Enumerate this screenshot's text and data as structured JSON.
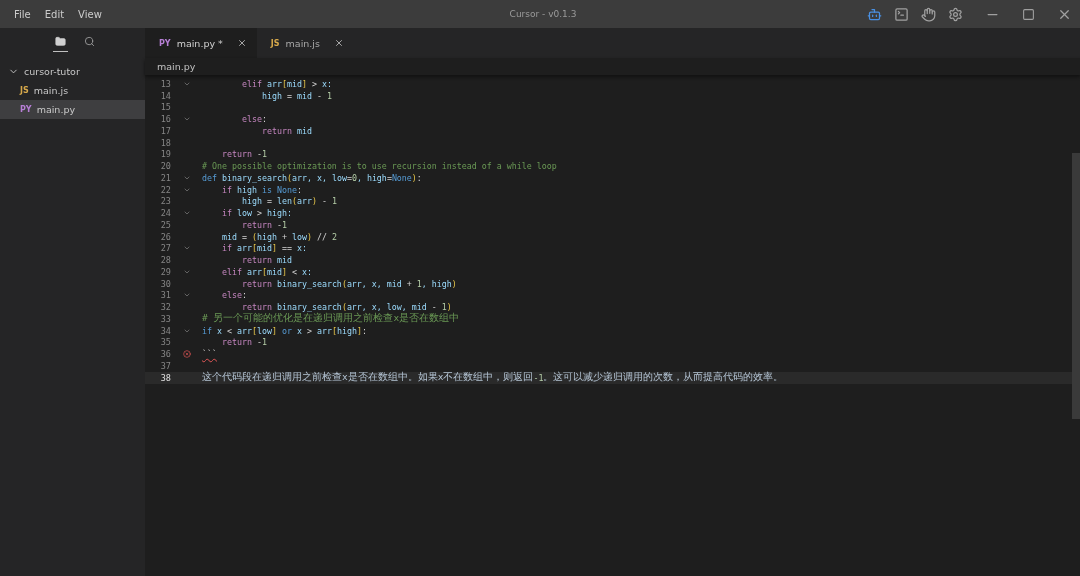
{
  "window": {
    "title": "Cursor - v0.1.3"
  },
  "menu": [
    "File",
    "Edit",
    "View"
  ],
  "toolbar": [
    {
      "kind": "bot",
      "active": true
    },
    {
      "kind": "terminal",
      "active": false
    },
    {
      "kind": "hand",
      "active": false
    },
    {
      "kind": "settings",
      "active": false
    }
  ],
  "sidebar": {
    "tabs": [
      {
        "kind": "files",
        "selected": true
      },
      {
        "kind": "search",
        "selected": false
      }
    ],
    "tree": [
      {
        "label": "cursor-tutor",
        "expanded": true,
        "selected": false,
        "children": [
          {
            "badge": "JS",
            "color": "#d7a94b",
            "label": "main.js",
            "selected": false
          },
          {
            "badge": "PY",
            "color": "#b77fd6",
            "label": "main.py",
            "selected": true
          }
        ]
      }
    ]
  },
  "tabs": [
    {
      "badge": "PY",
      "color": "#b77fd6",
      "label": "main.py *",
      "selected": true
    },
    {
      "badge": "JS",
      "color": "#d7a94b",
      "label": "main.js",
      "selected": false
    }
  ],
  "breadcrumb": "main.py",
  "lines": [
    {
      "number": "13",
      "fold": true,
      "error": false,
      "current": false,
      "tokens": [
        {
          "kind": "k",
          "text": "        elif"
        },
        {
          "kind": "p",
          "text": " arr"
        },
        {
          "kind": "b",
          "text": "["
        },
        {
          "kind": "p",
          "text": "mid"
        },
        {
          "kind": "b",
          "text": "]"
        },
        {
          "kind": "o",
          "text": " > "
        },
        {
          "kind": "p",
          "text": "x:"
        }
      ]
    },
    {
      "number": "14",
      "fold": false,
      "error": false,
      "current": false,
      "tokens": [
        {
          "kind": "p",
          "text": "            high "
        },
        {
          "kind": "o",
          "text": "= "
        },
        {
          "kind": "p",
          "text": "mid "
        },
        {
          "kind": "o",
          "text": "- "
        },
        {
          "kind": "n",
          "text": "1"
        }
      ]
    },
    {
      "number": "15",
      "fold": false,
      "error": false,
      "current": false
    },
    {
      "number": "16",
      "fold": true,
      "error": false,
      "current": false,
      "tokens": [
        {
          "kind": "k",
          "text": "        else"
        },
        {
          "kind": "o",
          "text": ":"
        }
      ]
    },
    {
      "number": "17",
      "fold": false,
      "error": false,
      "current": false,
      "tokens": [
        {
          "kind": "k",
          "text": "            return"
        },
        {
          "kind": "p",
          "text": " mid"
        }
      ]
    },
    {
      "number": "18",
      "fold": false,
      "error": false,
      "current": false
    },
    {
      "number": "19",
      "fold": false,
      "error": false,
      "current": false,
      "tokens": [
        {
          "kind": "k",
          "text": "    return"
        },
        {
          "kind": "o",
          "text": " -"
        },
        {
          "kind": "n",
          "text": "1"
        }
      ]
    },
    {
      "number": "20",
      "fold": false,
      "error": false,
      "current": false,
      "tokens": [
        {
          "kind": "c",
          "text": "# One possible optimization is to use recursion instead of a while loop"
        }
      ]
    },
    {
      "number": "21",
      "fold": true,
      "error": false,
      "current": false,
      "tokens": [
        {
          "kind": "d",
          "text": "def"
        },
        {
          "kind": "f",
          "text": " binary_search"
        },
        {
          "kind": "b",
          "text": "("
        },
        {
          "kind": "p",
          "text": "arr, x, low"
        },
        {
          "kind": "o",
          "text": "="
        },
        {
          "kind": "n",
          "text": "0"
        },
        {
          "kind": "p",
          "text": ", high"
        },
        {
          "kind": "o",
          "text": "="
        },
        {
          "kind": "d",
          "text": "None"
        },
        {
          "kind": "b",
          "text": ")"
        },
        {
          "kind": "o",
          "text": ":"
        }
      ]
    },
    {
      "number": "22",
      "fold": true,
      "error": false,
      "current": false,
      "tokens": [
        {
          "kind": "k",
          "text": "    if"
        },
        {
          "kind": "p",
          "text": " high "
        },
        {
          "kind": "d",
          "text": "is None"
        },
        {
          "kind": "o",
          "text": ":"
        }
      ]
    },
    {
      "number": "23",
      "fold": false,
      "error": false,
      "current": false,
      "tokens": [
        {
          "kind": "p",
          "text": "        high "
        },
        {
          "kind": "o",
          "text": "= "
        },
        {
          "kind": "f",
          "text": "len"
        },
        {
          "kind": "b",
          "text": "("
        },
        {
          "kind": "p",
          "text": "arr"
        },
        {
          "kind": "b",
          "text": ")"
        },
        {
          "kind": "o",
          "text": " - "
        },
        {
          "kind": "n",
          "text": "1"
        }
      ]
    },
    {
      "number": "24",
      "fold": true,
      "error": false,
      "current": false,
      "tokens": [
        {
          "kind": "k",
          "text": "    if"
        },
        {
          "kind": "p",
          "text": " low "
        },
        {
          "kind": "o",
          "text": "> "
        },
        {
          "kind": "p",
          "text": "high:"
        }
      ]
    },
    {
      "number": "25",
      "fold": false,
      "error": false,
      "current": false,
      "tokens": [
        {
          "kind": "k",
          "text": "        return"
        },
        {
          "kind": "o",
          "text": " -"
        },
        {
          "kind": "n",
          "text": "1"
        }
      ]
    },
    {
      "number": "26",
      "fold": false,
      "error": false,
      "current": false,
      "tokens": [
        {
          "kind": "p",
          "text": "    mid "
        },
        {
          "kind": "o",
          "text": "= "
        },
        {
          "kind": "b",
          "text": "("
        },
        {
          "kind": "p",
          "text": "high "
        },
        {
          "kind": "o",
          "text": "+ "
        },
        {
          "kind": "p",
          "text": "low"
        },
        {
          "kind": "b",
          "text": ")"
        },
        {
          "kind": "o",
          "text": " // "
        },
        {
          "kind": "n",
          "text": "2"
        }
      ]
    },
    {
      "number": "27",
      "fold": true,
      "error": false,
      "current": false,
      "tokens": [
        {
          "kind": "k",
          "text": "    if"
        },
        {
          "kind": "p",
          "text": " arr"
        },
        {
          "kind": "b",
          "text": "["
        },
        {
          "kind": "p",
          "text": "mid"
        },
        {
          "kind": "b",
          "text": "]"
        },
        {
          "kind": "o",
          "text": " == "
        },
        {
          "kind": "p",
          "text": "x:"
        }
      ]
    },
    {
      "number": "28",
      "fold": false,
      "error": false,
      "current": false,
      "tokens": [
        {
          "kind": "k",
          "text": "        return"
        },
        {
          "kind": "p",
          "text": " mid"
        }
      ]
    },
    {
      "number": "29",
      "fold": true,
      "error": false,
      "current": false,
      "tokens": [
        {
          "kind": "k",
          "text": "    elif"
        },
        {
          "kind": "p",
          "text": " arr"
        },
        {
          "kind": "b",
          "text": "["
        },
        {
          "kind": "p",
          "text": "mid"
        },
        {
          "kind": "b",
          "text": "]"
        },
        {
          "kind": "o",
          "text": " < "
        },
        {
          "kind": "p",
          "text": "x:"
        }
      ]
    },
    {
      "number": "30",
      "fold": false,
      "error": false,
      "current": false,
      "tokens": [
        {
          "kind": "k",
          "text": "        return"
        },
        {
          "kind": "f",
          "text": " binary_search"
        },
        {
          "kind": "b",
          "text": "("
        },
        {
          "kind": "p",
          "text": "arr, x, mid "
        },
        {
          "kind": "o",
          "text": "+ "
        },
        {
          "kind": "n",
          "text": "1"
        },
        {
          "kind": "p",
          "text": ", high"
        },
        {
          "kind": "b",
          "text": ")"
        }
      ]
    },
    {
      "number": "31",
      "fold": true,
      "error": false,
      "current": false,
      "tokens": [
        {
          "kind": "k",
          "text": "    else"
        },
        {
          "kind": "o",
          "text": ":"
        }
      ]
    },
    {
      "number": "32",
      "fold": false,
      "error": false,
      "current": false,
      "tokens": [
        {
          "kind": "k",
          "text": "        return"
        },
        {
          "kind": "f",
          "text": " binary_search"
        },
        {
          "kind": "b",
          "text": "("
        },
        {
          "kind": "p",
          "text": "arr, x, low, mid "
        },
        {
          "kind": "o",
          "text": "- "
        },
        {
          "kind": "n",
          "text": "1"
        },
        {
          "kind": "b",
          "text": ")"
        }
      ]
    },
    {
      "number": "33",
      "fold": false,
      "error": false,
      "current": false,
      "tokens": [
        {
          "kind": "c",
          "text": "# 另一个可能的优化是在递归调用之前检查x是否在数组中"
        }
      ]
    },
    {
      "number": "34",
      "fold": true,
      "error": false,
      "current": false,
      "tokens": [
        {
          "kind": "d",
          "text": "if"
        },
        {
          "kind": "p",
          "text": " x "
        },
        {
          "kind": "o",
          "text": "< "
        },
        {
          "kind": "p",
          "text": "arr"
        },
        {
          "kind": "b",
          "text": "["
        },
        {
          "kind": "p",
          "text": "low"
        },
        {
          "kind": "b",
          "text": "]"
        },
        {
          "kind": "d",
          "text": " or"
        },
        {
          "kind": "p",
          "text": " x "
        },
        {
          "kind": "o",
          "text": "> "
        },
        {
          "kind": "p",
          "text": "arr"
        },
        {
          "kind": "b",
          "text": "["
        },
        {
          "kind": "p",
          "text": "high"
        },
        {
          "kind": "b",
          "text": "]"
        },
        {
          "kind": "o",
          "text": ":"
        }
      ]
    },
    {
      "number": "35",
      "fold": false,
      "error": false,
      "current": false,
      "tokens": [
        {
          "kind": "k",
          "text": "    return"
        },
        {
          "kind": "o",
          "text": " -"
        },
        {
          "kind": "n",
          "text": "1"
        }
      ]
    },
    {
      "number": "36",
      "fold": false,
      "error": true,
      "current": false,
      "tokens": [
        {
          "kind": "o",
          "text": "```"
        }
      ]
    },
    {
      "number": "37",
      "fold": false,
      "error": false,
      "current": false
    },
    {
      "number": "38",
      "fold": false,
      "error": false,
      "current": true,
      "tokens": [
        {
          "kind": "t",
          "text": "这个代码段在递归调用之前检查x是否在数组中。如果x不在数组中，则返回"
        },
        {
          "kind": "n",
          "text": "-1"
        },
        {
          "kind": "t",
          "text": "。这可以减少递归调用的次数，从而提高代码的效率。"
        }
      ]
    }
  ]
}
